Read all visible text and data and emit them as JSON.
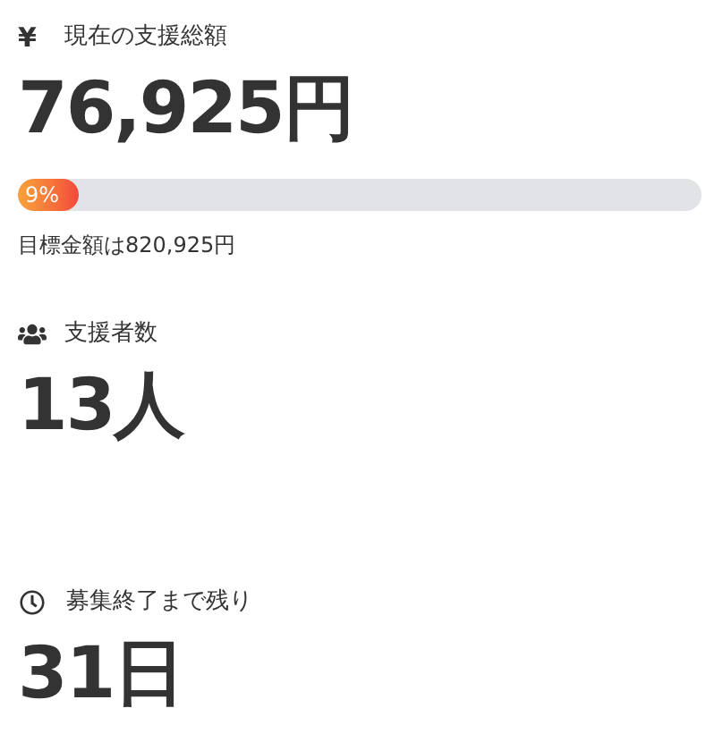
{
  "stats": [
    {
      "kind": "amount",
      "icon": "¥",
      "label": "現在の支援総額",
      "value": "76,925円",
      "progress": {
        "label": "9%",
        "level": 0.09
      },
      "goal": "目標金額は820,925円"
    },
    {
      "kind": "supporters",
      "label": "支援者数",
      "value": "13人"
    },
    {
      "kind": "days",
      "label": "募集終了まで残り",
      "value": "31日"
    }
  ]
}
